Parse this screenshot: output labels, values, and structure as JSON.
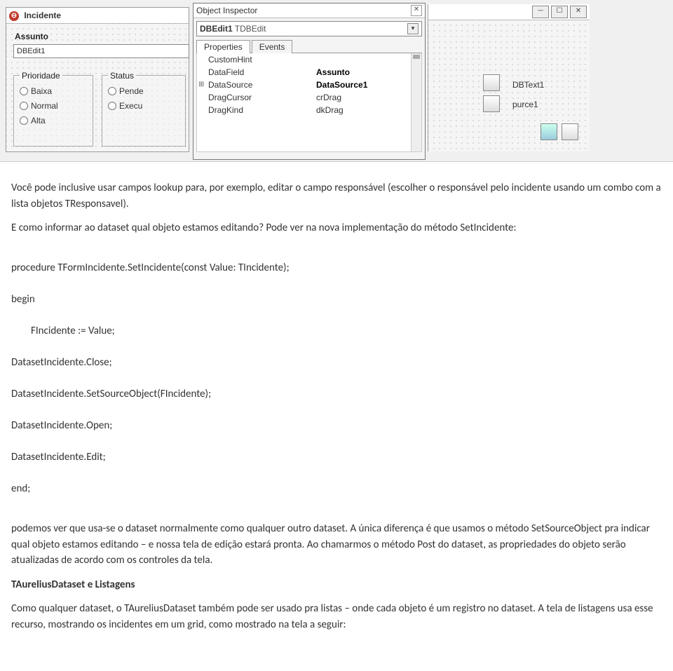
{
  "form": {
    "title": "Incidente",
    "field_label": "Assunto",
    "dbedit_caption": "DBEdit1",
    "priority": {
      "title": "Prioridade",
      "options": [
        "Baixa",
        "Normal",
        "Alta"
      ]
    },
    "status": {
      "title": "Status",
      "options": [
        "Pende",
        "Execu"
      ]
    }
  },
  "inspector": {
    "title": "Object Inspector",
    "combo_main": "DBEdit1",
    "combo_type": "TDBEdit",
    "tabs": {
      "properties": "Properties",
      "events": "Events"
    },
    "props": {
      "customhint": {
        "name": "CustomHint",
        "val": ""
      },
      "datafield": {
        "name": "DataField",
        "val": "Assunto"
      },
      "datasource": {
        "name": "DataSource",
        "val": "DataSource1"
      },
      "dragcursor": {
        "name": "DragCursor",
        "val": "crDrag"
      },
      "dragkind": {
        "name": "DragKind",
        "val": "dkDrag"
      }
    }
  },
  "right": {
    "dbtext": "DBText1",
    "purce": "purce1"
  },
  "article": {
    "p1": "Você pode inclusive usar campos lookup para, por exemplo, editar o campo responsável (escolher o responsável pelo incidente usando um combo com a lista objetos TResponsavel).",
    "p2": "E como informar ao dataset qual objeto estamos editando? Pode ver na nova implementação do método SetIncidente:",
    "code": {
      "l1": "procedure TFormIncidente.SetIncidente(const Value: TIncidente);",
      "l2": "begin",
      "l3": "FIncidente := Value;",
      "l4": "DatasetIncidente.Close;",
      "l5": "DatasetIncidente.SetSourceObject(FIncidente);",
      "l6": "DatasetIncidente.Open;",
      "l7": "DatasetIncidente.Edit;",
      "l8": "end;"
    },
    "p3": "podemos ver que usa-se o dataset normalmente como qualquer outro dataset. A única diferença é que usamos o método SetSourceObject pra indicar qual objeto estamos editando – e nossa tela de edição estará pronta. Ao chamarmos o método Post do dataset, as propriedades do objeto serão atualizadas de acordo com os controles da tela.",
    "h1": "TAureliusDataset e Listagens",
    "p4": "Como qualquer dataset, o TAureliusDataset também pode ser usado pra listas – onde cada objeto é um registro no dataset. A tela de listagens usa esse recurso, mostrando os incidentes em um grid, como mostrado na tela a seguir:"
  }
}
